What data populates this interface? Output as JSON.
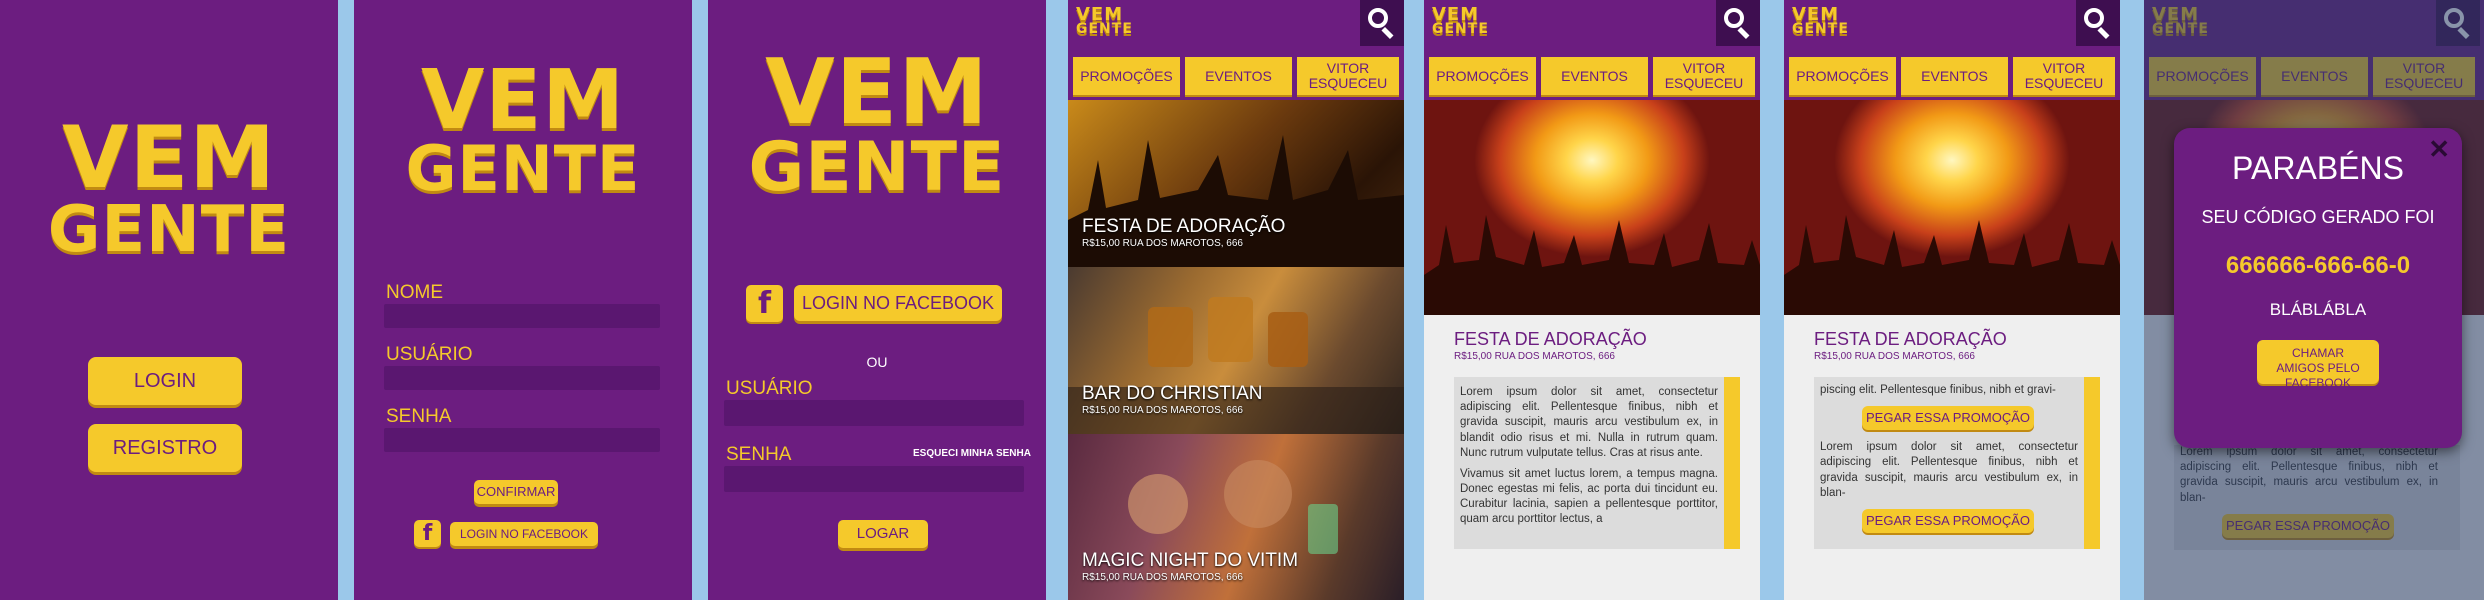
{
  "logo": {
    "line1": "VEM",
    "line2": "GENTE"
  },
  "splash": {
    "login": "LOGIN",
    "register": "REGISTRO"
  },
  "register": {
    "name_label": "NOME",
    "user_label": "USUÁRIO",
    "password_label": "SENHA",
    "confirm": "CONFIRMAR",
    "facebook_login": "LOGIN NO FACEBOOK"
  },
  "login": {
    "facebook_login": "LOGIN NO FACEBOOK",
    "or": "OU",
    "user_label": "USUÁRIO",
    "password_label": "SENHA",
    "forgot": "ESQUECI MINHA SENHA",
    "submit": "LOGAR"
  },
  "nav": {
    "tab1": "PROMOÇÕES",
    "tab2": "EVENTOS",
    "tab3": "VITOR ESQUECEU"
  },
  "events": [
    {
      "title": "FESTA DE ADORAÇÃO",
      "sub": "R$15,00   RUA DOS MAROTOS, 666"
    },
    {
      "title": "BAR DO CHRISTIAN",
      "sub": "R$15,00   RUA DOS MAROTOS, 666"
    },
    {
      "title": "MAGIC NIGHT DO VITIM",
      "sub": "R$15,00   RUA DOS MAROTOS, 666"
    }
  ],
  "detail": {
    "title": "FESTA DE ADORAÇÃO",
    "sub": "R$15,00   RUA DOS MAROTOS, 666",
    "p1": "Lorem ipsum dolor sit amet, consectetur adipiscing elit. Pellentesque finibus, nibh et gravida suscipit, mauris arcu vestibulum ex, in blandit odio risus et mi. Nulla in rutrum quam. Nunc rutrum vulputate tellus. Cras at risus ante.",
    "p2": "Vivamus sit amet luctus lorem, a tempus magna. Donec egestas mi felis, ac porta dui tincidunt eu. Curabitur lacinia, sapien a pellentesque porttitor, quam arcu porttitor lectus, a",
    "p_top": "piscing elit. Pellentesque finibus, nibh et gravi-",
    "p3": "Lorem ipsum dolor sit amet, consectetur adipiscing elit. Pellentesque finibus, nibh et gravida suscipit, mauris arcu vestibulum ex, in blan-",
    "promo_button": "PEGAR ESSA PROMOÇÃO"
  },
  "modal": {
    "title": "PARABÉNS",
    "line1": "SEU CÓDIGO GERADO FOI",
    "code": "666666-666-66-0",
    "line2": "BLÁBLÁBLA",
    "share": "CHAMAR AMIGOS PELO FACEBOOK",
    "close": "✕"
  },
  "colors": {
    "purple": "#6c1d80",
    "yellow": "#f5c92b",
    "background": "#9bc8ea"
  }
}
